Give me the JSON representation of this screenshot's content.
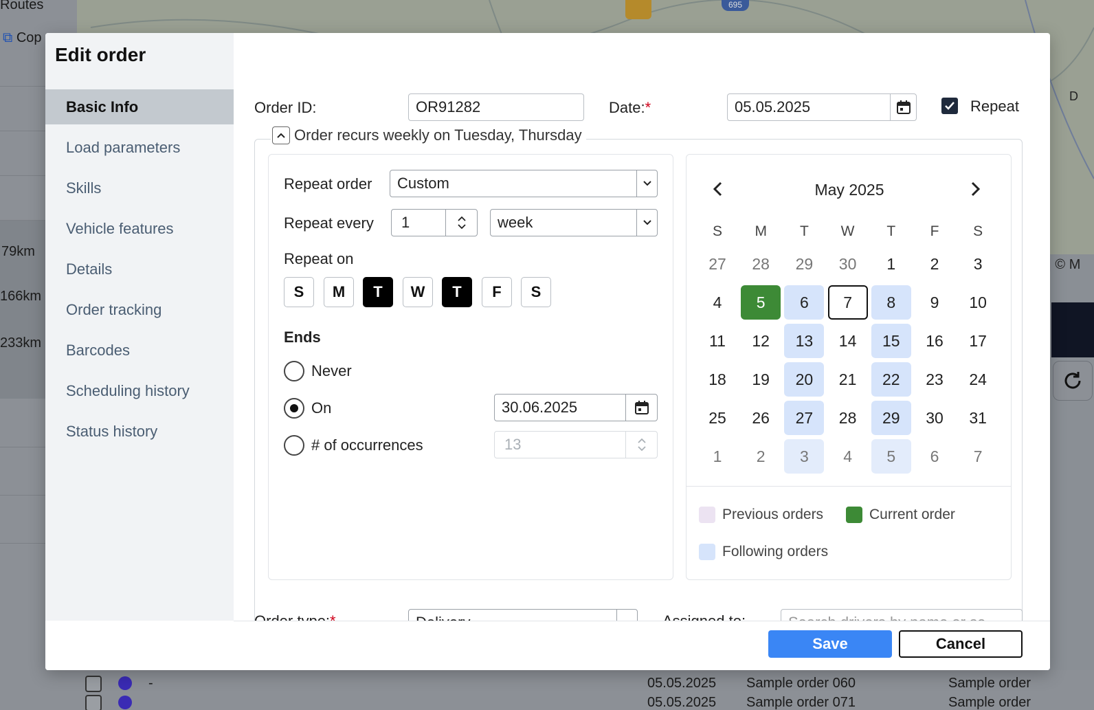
{
  "background": {
    "routes_label": "Routes",
    "copy_label": "Cop",
    "distances": [
      "79km",
      "166km",
      "233km"
    ],
    "map_badge": "695",
    "map_attrib": "e | © M",
    "map_letter": "D",
    "table_row": {
      "id": "-",
      "date": "05.05.2025",
      "name": "Sample order 060",
      "type": "Sample order"
    },
    "table_row2": {
      "date": "05.05.2025",
      "name": "Sample order 071",
      "type": "Sample order"
    }
  },
  "modal": {
    "title": "Edit order",
    "nav": [
      {
        "label": "Basic Info",
        "active": true
      },
      {
        "label": "Load parameters"
      },
      {
        "label": "Skills"
      },
      {
        "label": "Vehicle features"
      },
      {
        "label": "Details"
      },
      {
        "label": "Order tracking"
      },
      {
        "label": "Barcodes"
      },
      {
        "label": "Scheduling history"
      },
      {
        "label": "Status history"
      }
    ],
    "order_id_label": "Order ID:",
    "order_id_value": "OR91282",
    "date_label": "Date:",
    "date_required": "*",
    "date_value": "05.05.2025",
    "repeat_label": "Repeat",
    "recurrence_summary": "Order recurs weekly on Tuesday, Thursday",
    "repeat_order_label": "Repeat order",
    "repeat_order_value": "Custom",
    "repeat_every_label": "Repeat every",
    "repeat_every_value": "1",
    "repeat_unit_value": "week",
    "repeat_on_label": "Repeat on",
    "weekdays": [
      {
        "label": "S",
        "on": false
      },
      {
        "label": "M",
        "on": false
      },
      {
        "label": "T",
        "on": true
      },
      {
        "label": "W",
        "on": false
      },
      {
        "label": "T",
        "on": true
      },
      {
        "label": "F",
        "on": false
      },
      {
        "label": "S",
        "on": false
      }
    ],
    "ends_label": "Ends",
    "never_label": "Never",
    "on_label": "On",
    "on_date_value": "30.06.2025",
    "occurrences_label": "# of occurrences",
    "occurrences_value": "13",
    "order_type_label": "Order type:",
    "order_type_value": "Delivery",
    "assigned_label": "Assigned to:",
    "assigned_placeholder": "Search drivers by name or se",
    "save_label": "Save",
    "cancel_label": "Cancel"
  },
  "calendar": {
    "month_label": "May 2025",
    "weekday_headers": [
      "S",
      "M",
      "T",
      "W",
      "T",
      "F",
      "S"
    ],
    "weeks": [
      [
        [
          "27",
          "muted"
        ],
        [
          "28",
          "muted"
        ],
        [
          "29",
          "muted"
        ],
        [
          "30",
          "muted"
        ],
        [
          "1",
          ""
        ],
        [
          "2",
          ""
        ],
        [
          "3",
          ""
        ]
      ],
      [
        [
          "4",
          ""
        ],
        [
          "5",
          "current"
        ],
        [
          "6",
          "follow"
        ],
        [
          "7",
          "today"
        ],
        [
          "8",
          "follow"
        ],
        [
          "9",
          ""
        ],
        [
          "10",
          ""
        ]
      ],
      [
        [
          "11",
          ""
        ],
        [
          "12",
          ""
        ],
        [
          "13",
          "follow"
        ],
        [
          "14",
          ""
        ],
        [
          "15",
          "follow"
        ],
        [
          "16",
          ""
        ],
        [
          "17",
          ""
        ]
      ],
      [
        [
          "18",
          ""
        ],
        [
          "19",
          ""
        ],
        [
          "20",
          "follow"
        ],
        [
          "21",
          ""
        ],
        [
          "22",
          "follow"
        ],
        [
          "23",
          ""
        ],
        [
          "24",
          ""
        ]
      ],
      [
        [
          "25",
          ""
        ],
        [
          "26",
          ""
        ],
        [
          "27",
          "follow"
        ],
        [
          "28",
          ""
        ],
        [
          "29",
          "follow"
        ],
        [
          "30",
          ""
        ],
        [
          "31",
          ""
        ]
      ],
      [
        [
          "1",
          "muted"
        ],
        [
          "2",
          "muted"
        ],
        [
          "3",
          "follow-muted"
        ],
        [
          "4",
          "muted"
        ],
        [
          "5",
          "follow-muted"
        ],
        [
          "6",
          "muted"
        ],
        [
          "7",
          "muted"
        ]
      ]
    ],
    "legend": {
      "previous": "Previous orders",
      "current": "Current order",
      "following": "Following orders"
    },
    "colors": {
      "previous": "#ece3f2",
      "current": "#3d8a36",
      "following": "#d6e4fb"
    }
  }
}
